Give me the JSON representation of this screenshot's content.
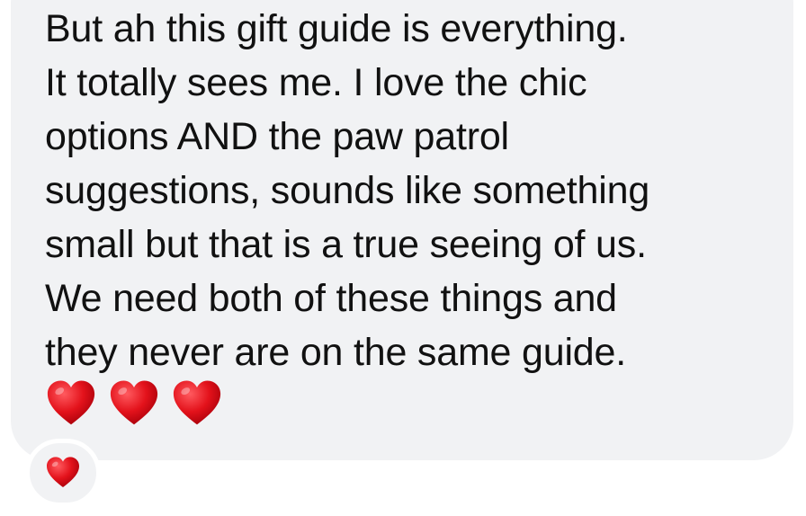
{
  "message": {
    "lines": [
      "But ah this gift guide is everything.",
      "It totally sees me. I love the chic",
      "options AND the paw patrol",
      "suggestions, sounds like something",
      "small but that is a true seeing of us.",
      "We need both of these things and",
      "they never are on the same guide."
    ],
    "emoji": [
      "red-heart",
      "red-heart",
      "red-heart"
    ]
  },
  "reaction": {
    "emoji": "red-heart"
  },
  "colors": {
    "bubble": "#f1f2f4",
    "text": "#111111",
    "heart": "#e3121b"
  }
}
